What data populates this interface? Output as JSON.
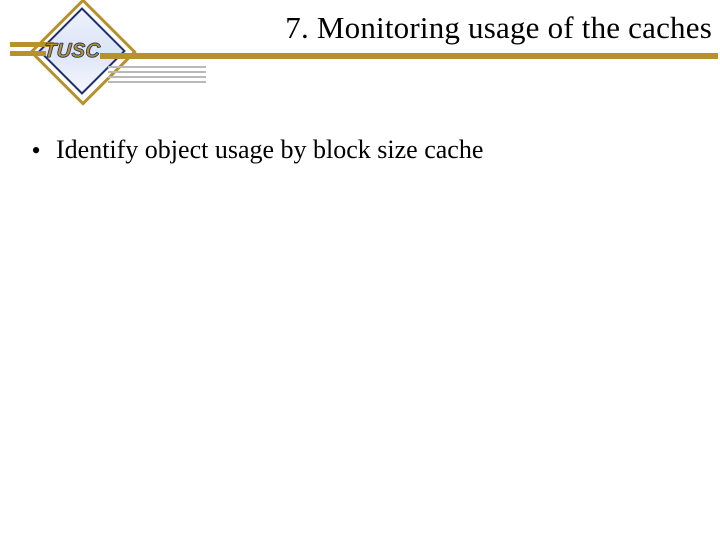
{
  "logo": {
    "text": "TUSC"
  },
  "title": "7. Monitoring usage of the caches",
  "bullets": [
    "Identify object usage by block size cache"
  ],
  "glyphs": {
    "bullet": "•"
  }
}
